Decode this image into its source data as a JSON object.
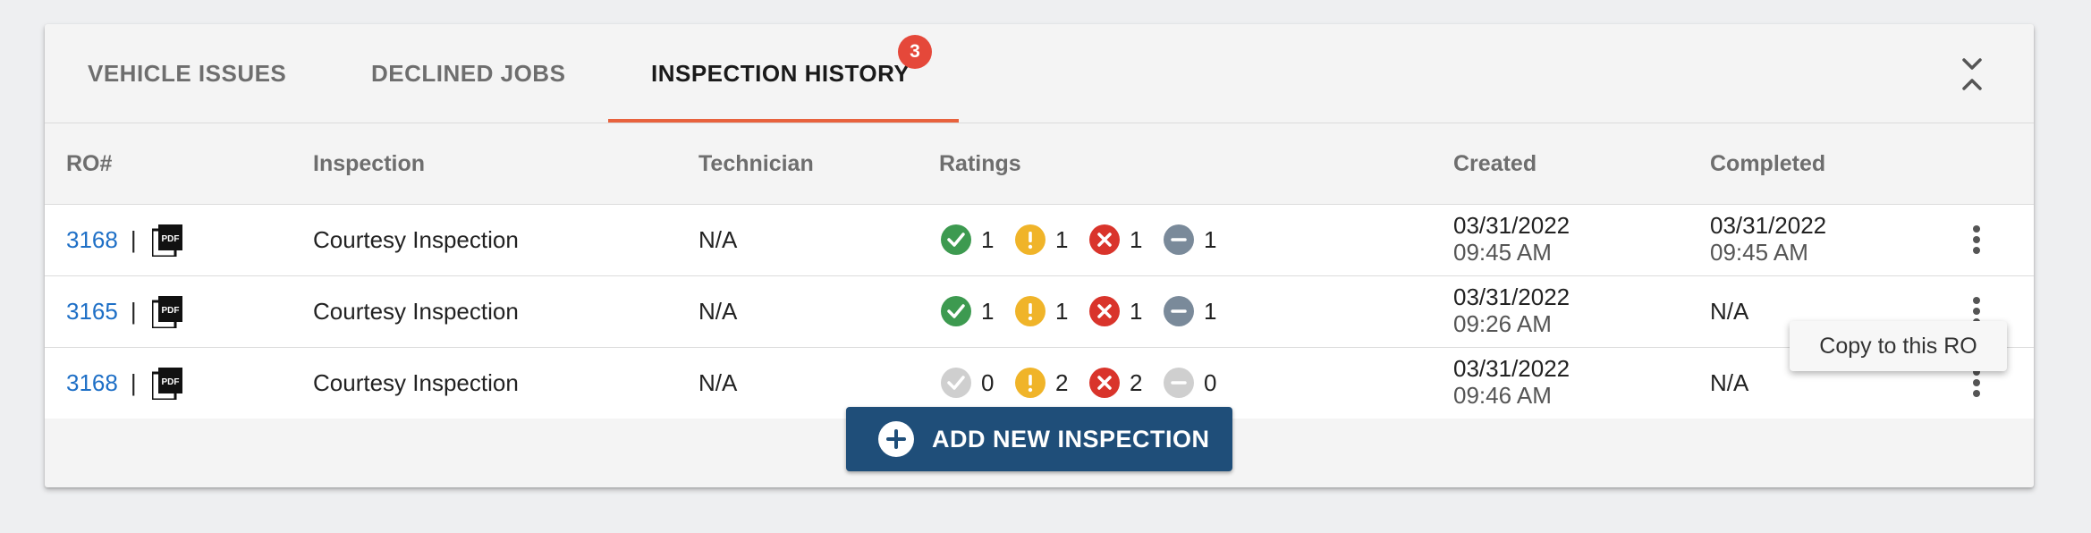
{
  "tabs": [
    {
      "label": "VEHICLE ISSUES"
    },
    {
      "label": "DECLINED JOBS"
    },
    {
      "label": "INSPECTION HISTORY",
      "badge": "3"
    }
  ],
  "active_tab": "INSPECTION HISTORY",
  "colors": {
    "accent_underline": "#e8623d",
    "badge": "#e5483a",
    "link": "#1e6fc6",
    "primary_button": "#1f4e79",
    "rating_pass": "#3d9a50",
    "rating_warn": "#f0b429",
    "rating_fail": "#d9342b",
    "rating_na": "#7a8a9a",
    "rating_disabled": "#cfcfcf"
  },
  "columns": {
    "ro": "RO#",
    "inspection": "Inspection",
    "technician": "Technician",
    "ratings": "Ratings",
    "created": "Created",
    "completed": "Completed"
  },
  "separator": "|",
  "rows": [
    {
      "ro": "3168",
      "inspection": "Courtesy Inspection",
      "technician": "N/A",
      "ratings": {
        "pass": "1",
        "warn": "1",
        "fail": "1",
        "na": "1"
      },
      "created_date": "03/31/2022",
      "created_time": "09:45 AM",
      "completed_date": "03/31/2022",
      "completed_time": "09:45 AM"
    },
    {
      "ro": "3165",
      "inspection": "Courtesy Inspection",
      "technician": "N/A",
      "ratings": {
        "pass": "1",
        "warn": "1",
        "fail": "1",
        "na": "1"
      },
      "created_date": "03/31/2022",
      "created_time": "09:26 AM",
      "completed": "N/A"
    },
    {
      "ro": "3168",
      "inspection": "Courtesy Inspection",
      "technician": "N/A",
      "ratings": {
        "pass": "0",
        "warn": "2",
        "fail": "2",
        "na": "0"
      },
      "created_date": "03/31/2022",
      "created_time": "09:46 AM",
      "completed": "N/A"
    }
  ],
  "icons": {
    "pdf": "pdf-file-icon",
    "pass": "check-circle-icon",
    "warn": "exclamation-circle-icon",
    "fail": "x-circle-icon",
    "na": "minus-circle-icon",
    "more": "more-vertical-icon",
    "collapse": "collapse-chevrons-icon",
    "add": "plus-circle-icon"
  },
  "add_button": {
    "label": "ADD NEW INSPECTION"
  },
  "context_menu": {
    "item": "Copy to this RO"
  }
}
